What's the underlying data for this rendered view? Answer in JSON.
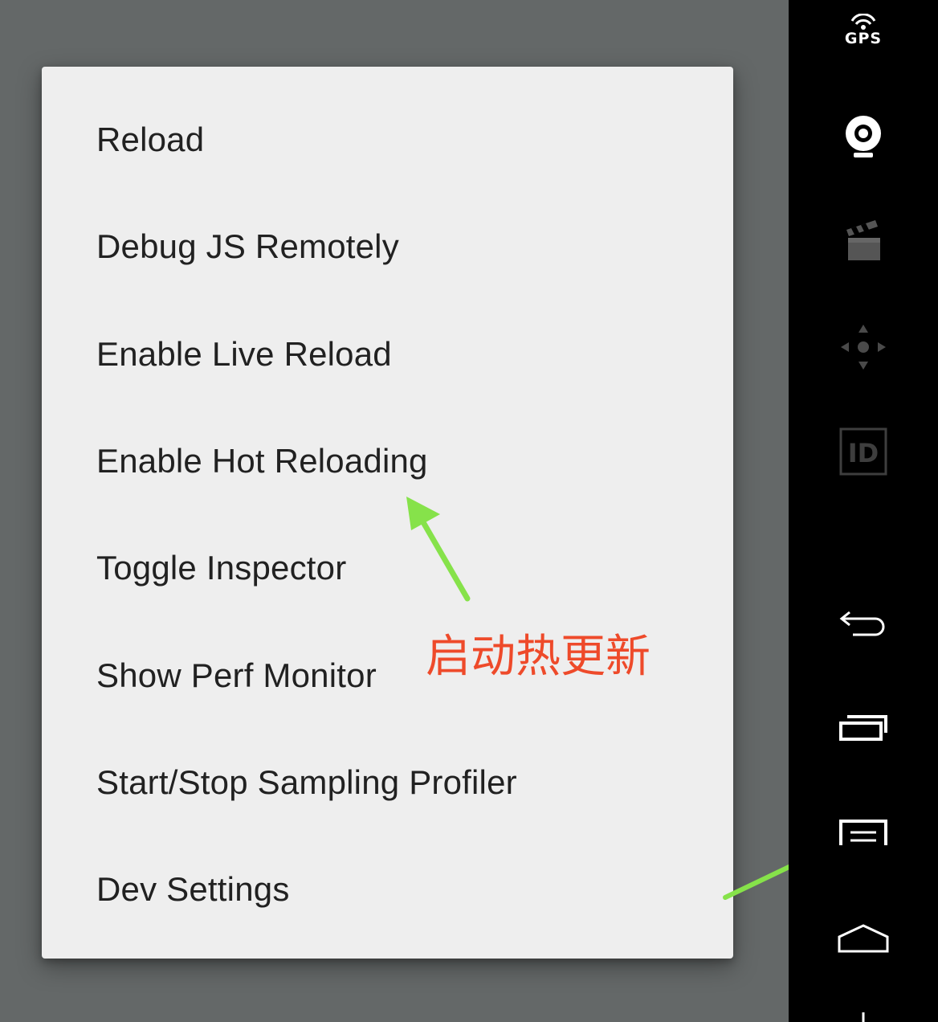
{
  "menu": {
    "items": [
      {
        "label": "Reload"
      },
      {
        "label": "Debug JS Remotely"
      },
      {
        "label": "Enable Live Reload"
      },
      {
        "label": "Enable Hot Reloading"
      },
      {
        "label": "Toggle Inspector"
      },
      {
        "label": "Show Perf Monitor"
      },
      {
        "label": "Start/Stop Sampling Profiler"
      },
      {
        "label": "Dev Settings"
      }
    ]
  },
  "annotation": {
    "text": "启动热更新",
    "color": "#ee4a2a",
    "arrow_color": "#86e24a"
  },
  "sidebar": {
    "gps_label": "GPS",
    "icons": [
      "gps-icon",
      "webcam-icon",
      "clapperboard-icon",
      "dpad-icon",
      "id-icon",
      "back-icon",
      "recent-apps-icon",
      "menu-icon",
      "home-icon"
    ]
  },
  "colors": {
    "backdrop": "#646868",
    "menu_bg": "#eeeeee",
    "menu_text": "#212121",
    "sidebar_bg": "#000000"
  }
}
